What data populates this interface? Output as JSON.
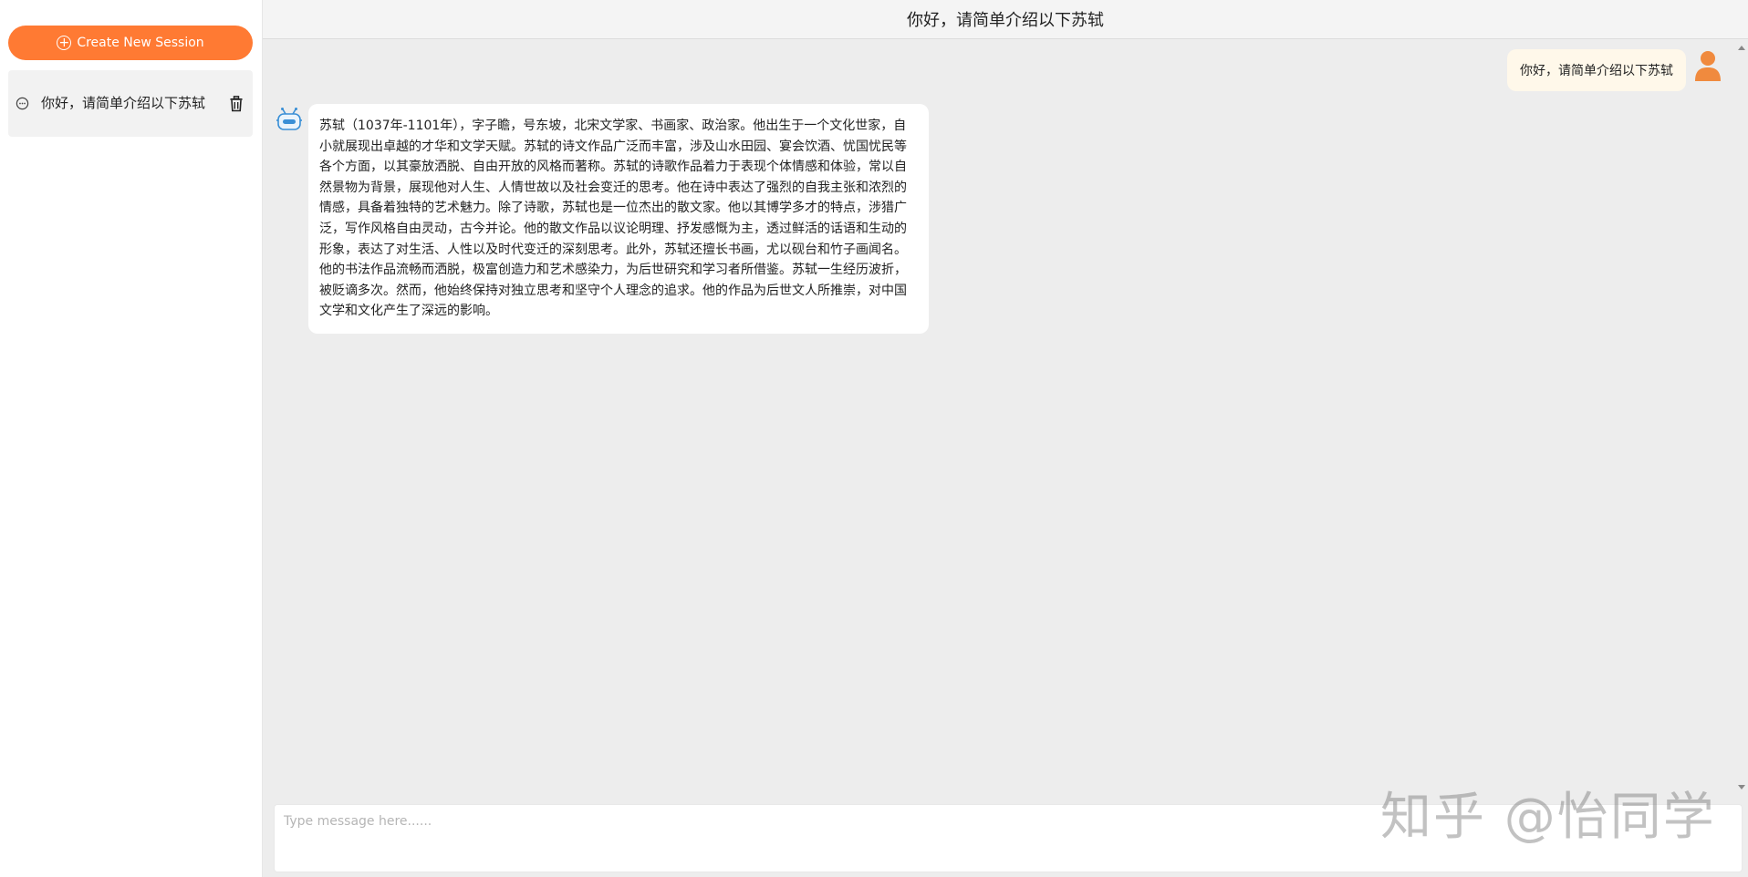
{
  "sidebar": {
    "new_session_label": "Create New Session",
    "sessions": [
      {
        "label": "你好，请简单介绍以下苏轼"
      }
    ]
  },
  "header": {
    "title": "你好，请简单介绍以下苏轼"
  },
  "messages": {
    "user": "你好，请简单介绍以下苏轼",
    "bot": "苏轼（1037年-1101年），字子瞻，号东坡，北宋文学家、书画家、政治家。他出生于一个文化世家，自小就展现出卓越的才华和文学天赋。苏轼的诗文作品广泛而丰富，涉及山水田园、宴会饮酒、忧国忧民等各个方面，以其豪放洒脱、自由开放的风格而著称。苏轼的诗歌作品着力于表现个体情感和体验，常以自然景物为背景，展现他对人生、人情世故以及社会变迁的思考。他在诗中表达了强烈的自我主张和浓烈的情感，具备着独特的艺术魅力。除了诗歌，苏轼也是一位杰出的散文家。他以其博学多才的特点，涉猎广泛，写作风格自由灵动，古今并论。他的散文作品以议论明理、抒发感慨为主，透过鲜活的话语和生动的形象，表达了对生活、人性以及时代变迁的深刻思考。此外，苏轼还擅长书画，尤以砚台和竹子画闻名。他的书法作品流畅而洒脱，极富创造力和艺术感染力，为后世研究和学习者所借鉴。苏轼一生经历波折，被贬谪多次。然而，他始终保持对独立思考和坚守个人理念的追求。他的作品为后世文人所推崇，对中国文学和文化产生了深远的影响。"
  },
  "input": {
    "placeholder": "Type message here......"
  },
  "watermark": "知乎 @怡同学",
  "colors": {
    "accent": "#ff7a33",
    "user_bubble": "#fff8ea",
    "chat_background": "#ededed"
  },
  "icons": {
    "new_session": "plus-circle-icon",
    "session": "chat-bubble-icon",
    "delete": "trash-icon",
    "user_avatar": "user-icon",
    "bot_avatar": "robot-icon"
  }
}
